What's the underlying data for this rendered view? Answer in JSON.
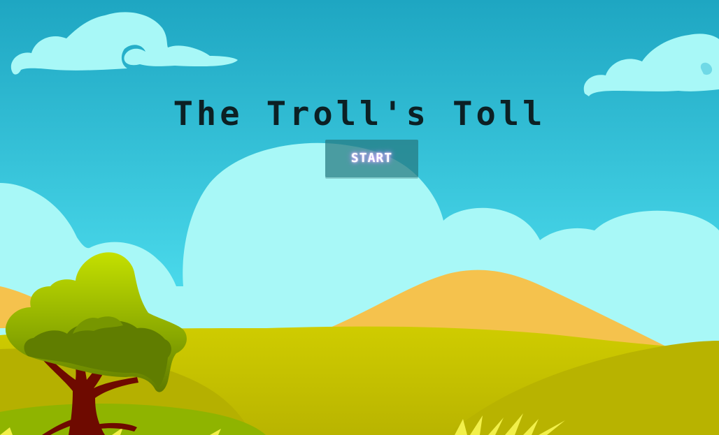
{
  "game": {
    "title": "The Troll's Toll",
    "start_label": "START"
  },
  "colors": {
    "sky_top": "#1ea6c2",
    "sky_bottom": "#58e2ee",
    "cloud": "#a8f8f7",
    "hill_orange": "#f5c24d",
    "hill_green": "#c9c900",
    "grass_dark": "#9fa800",
    "title_text": "#0c2024",
    "button_bg": "#267880",
    "button_glow": "#c79bff",
    "tree_trunk": "#6e0a00",
    "tree_foliage": "#8db000"
  }
}
